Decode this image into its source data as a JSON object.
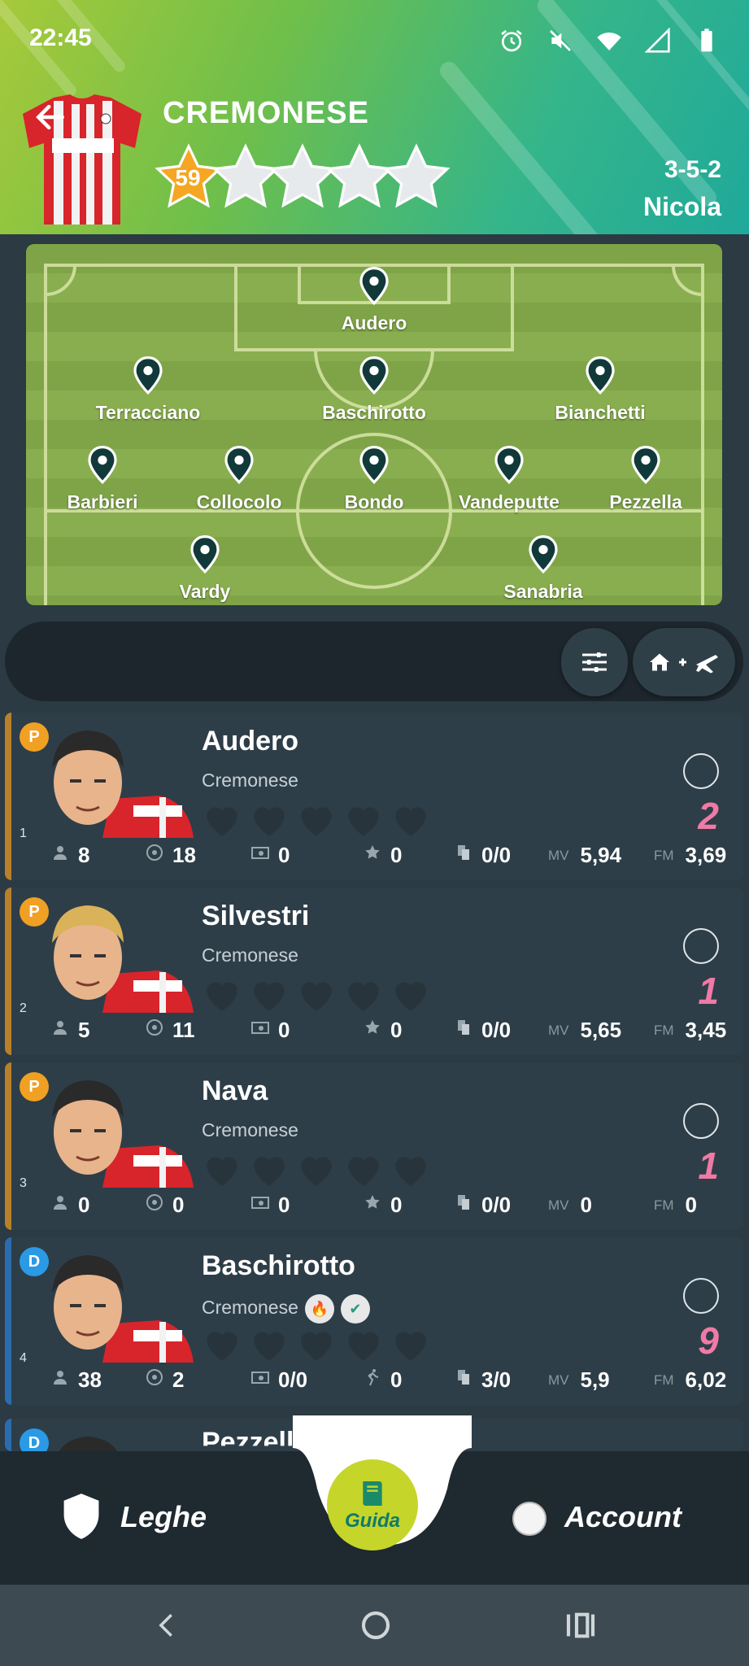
{
  "status_bar": {
    "time": "22:45"
  },
  "header": {
    "team_name": "CREMONESE",
    "rating": "59",
    "formation": "3-5-2",
    "coach": "Nicola"
  },
  "pitch": {
    "players": [
      "Audero",
      "Terracciano",
      "Baschirotto",
      "Bianchetti",
      "Barbieri",
      "Collocolo",
      "Bondo",
      "Vandeputte",
      "Pezzella",
      "Vardy",
      "Sanabria"
    ]
  },
  "players": [
    {
      "index": "1",
      "role": "P",
      "name": "Audero",
      "team": "Cremonese",
      "score": "2",
      "stats": {
        "a": "8",
        "b": "18",
        "c": "0",
        "d": "0",
        "cards": "0/0",
        "mv_label": "MV",
        "mv": "5,94",
        "fm_label": "FM",
        "fm": "3,69"
      }
    },
    {
      "index": "2",
      "role": "P",
      "name": "Silvestri",
      "team": "Cremonese",
      "score": "1",
      "stats": {
        "a": "5",
        "b": "11",
        "c": "0",
        "d": "0",
        "cards": "0/0",
        "mv_label": "MV",
        "mv": "5,65",
        "fm_label": "FM",
        "fm": "3,45"
      }
    },
    {
      "index": "3",
      "role": "P",
      "name": "Nava",
      "team": "Cremonese",
      "score": "1",
      "stats": {
        "a": "0",
        "b": "0",
        "c": "0",
        "d": "0",
        "cards": "0/0",
        "mv_label": "MV",
        "mv": "0",
        "fm_label": "FM",
        "fm": "0"
      }
    },
    {
      "index": "4",
      "role": "D",
      "name": "Baschirotto",
      "team": "Cremonese",
      "score": "9",
      "stats": {
        "a": "38",
        "b": "2",
        "c": "0/0",
        "d": "0",
        "cards": "3/0",
        "mv_label": "MV",
        "mv": "5,9",
        "fm_label": "FM",
        "fm": "6,02"
      }
    },
    {
      "index": "",
      "role": "D",
      "name": "Pezzella",
      "team": "",
      "score": "",
      "stats": {}
    }
  ],
  "bottom_nav": {
    "leagues": "Leghe",
    "guide": "Guida",
    "account": "Account"
  },
  "colors": {
    "goalkeeper": "#f0a023",
    "defender": "#2a9ae6",
    "score": "#f07aa6",
    "gk_bar": "#b8802a",
    "def_bar": "#2a6cae"
  }
}
